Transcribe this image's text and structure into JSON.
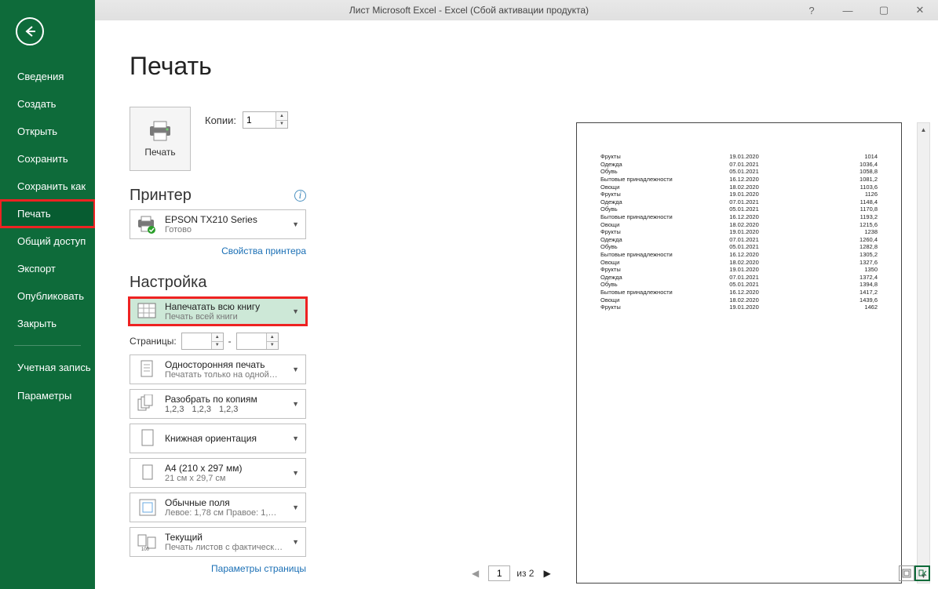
{
  "titlebar": {
    "text": "Лист Microsoft Excel - Excel (Сбой активации продукта)",
    "help": "?",
    "min": "—",
    "max": "▢",
    "close": "✕"
  },
  "sidebar": {
    "items": [
      "Сведения",
      "Создать",
      "Открыть",
      "Сохранить",
      "Сохранить как",
      "Печать",
      "Общий доступ",
      "Экспорт",
      "Опубликовать",
      "Закрыть"
    ],
    "account": "Учетная запись",
    "options": "Параметры"
  },
  "page": {
    "title": "Печать"
  },
  "print": {
    "button": "Печать",
    "copies_label": "Копии:",
    "copies_value": "1"
  },
  "printer": {
    "heading": "Принтер",
    "name": "EPSON TX210 Series",
    "status": "Готово",
    "props_link": "Свойства принтера"
  },
  "settings": {
    "heading": "Настройка",
    "what": {
      "title": "Напечатать всю книгу",
      "sub": "Печать всей книги"
    },
    "pages_label": "Страницы:",
    "pages_sep": "-",
    "sides": {
      "title": "Односторонняя печать",
      "sub": "Печатать только на одной…"
    },
    "collate": {
      "title": "Разобрать по копиям",
      "sub1": "1,2,3",
      "sub2": "1,2,3",
      "sub3": "1,2,3"
    },
    "orient": {
      "title": "Книжная ориентация"
    },
    "paper": {
      "title": "A4 (210 x 297 мм)",
      "sub": "21 см x 29,7 см"
    },
    "margins": {
      "title": "Обычные поля",
      "sub": "Левое:  1,78 см   Правое:  1,…"
    },
    "scaling": {
      "title": "Текущий",
      "sub": "Печать листов с фактическ…"
    },
    "page_setup_link": "Параметры страницы"
  },
  "nav": {
    "page_value": "1",
    "of_text": "из 2"
  },
  "preview_rows": [
    [
      "Фрукты",
      "19.01.2020",
      "1014"
    ],
    [
      "Одежда",
      "07.01.2021",
      "1036,4"
    ],
    [
      "Обувь",
      "05.01.2021",
      "1058,8"
    ],
    [
      "Бытовые принадлежности",
      "16.12.2020",
      "1081,2"
    ],
    [
      "Овощи",
      "18.02.2020",
      "1103,6"
    ],
    [
      "Фрукты",
      "19.01.2020",
      "1126"
    ],
    [
      "Одежда",
      "07.01.2021",
      "1148,4"
    ],
    [
      "Обувь",
      "05.01.2021",
      "1170,8"
    ],
    [
      "Бытовые принадлежности",
      "16.12.2020",
      "1193,2"
    ],
    [
      "Овощи",
      "18.02.2020",
      "1215,6"
    ],
    [
      "Фрукты",
      "19.01.2020",
      "1238"
    ],
    [
      "Одежда",
      "07.01.2021",
      "1260,4"
    ],
    [
      "Обувь",
      "05.01.2021",
      "1282,8"
    ],
    [
      "Бытовые принадлежности",
      "16.12.2020",
      "1305,2"
    ],
    [
      "Овощи",
      "18.02.2020",
      "1327,6"
    ],
    [
      "Фрукты",
      "19.01.2020",
      "1350"
    ],
    [
      "Одежда",
      "07.01.2021",
      "1372,4"
    ],
    [
      "Обувь",
      "05.01.2021",
      "1394,8"
    ],
    [
      "Бытовые принадлежности",
      "16.12.2020",
      "1417,2"
    ],
    [
      "Овощи",
      "18.02.2020",
      "1439,6"
    ],
    [
      "Фрукты",
      "19.01.2020",
      "1462"
    ]
  ]
}
